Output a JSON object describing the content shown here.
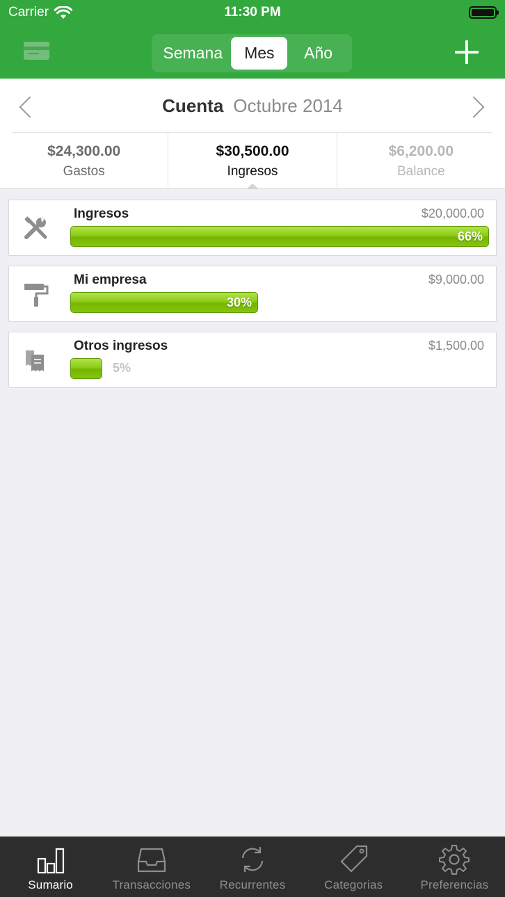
{
  "status_bar": {
    "carrier": "Carrier",
    "time": "11:30 PM"
  },
  "nav": {
    "segments": [
      "Semana",
      "Mes",
      "Año"
    ],
    "selected_segment": "Mes"
  },
  "header": {
    "account": "Cuenta",
    "period": "Octubre 2014"
  },
  "summary": [
    {
      "amount": "$24,300.00",
      "label": "Gastos"
    },
    {
      "amount": "$30,500.00",
      "label": "Ingresos"
    },
    {
      "amount": "$6,200.00",
      "label": "Balance"
    }
  ],
  "selected_summary": "Ingresos",
  "categories": [
    {
      "name": "Ingresos",
      "amount": "$20,000.00",
      "percent_label": "66%",
      "percent": 66,
      "icon": "tools-icon"
    },
    {
      "name": "Mi empresa",
      "amount": "$9,000.00",
      "percent_label": "30%",
      "percent": 30,
      "icon": "paint-roller-icon"
    },
    {
      "name": "Otros ingresos",
      "amount": "$1,500.00",
      "percent_label": "5%",
      "percent": 5,
      "icon": "receipts-icon"
    }
  ],
  "tabs": [
    {
      "label": "Sumario",
      "icon": "bar-chart-icon"
    },
    {
      "label": "Transacciones",
      "icon": "inbox-icon"
    },
    {
      "label": "Recurrentes",
      "icon": "refresh-icon"
    },
    {
      "label": "Categorias",
      "icon": "tag-icon"
    },
    {
      "label": "Preferencias",
      "icon": "gear-icon"
    }
  ],
  "active_tab": "Sumario",
  "colors": {
    "nav_green": "#33a83f",
    "bar_green": "#8ccc17",
    "tabbar": "#2d2d2d"
  }
}
